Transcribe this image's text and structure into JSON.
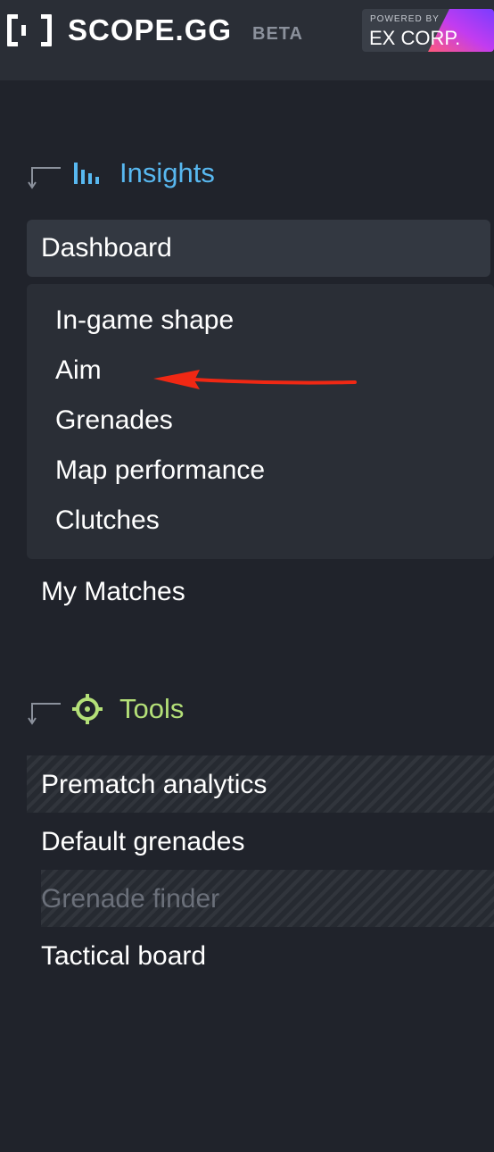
{
  "header": {
    "logo_text": "SCOPE.GG",
    "beta_badge": "BETA",
    "powered_by_label": "POWERED BY",
    "partner_name": "EX CORP."
  },
  "sidebar": {
    "insights": {
      "title": "Insights",
      "icon": "bar-chart-icon",
      "accent": "#58b8f0",
      "items": [
        {
          "label": "Dashboard",
          "active": true
        },
        {
          "label": "In-game shape"
        },
        {
          "label": "Aim"
        },
        {
          "label": "Grenades"
        },
        {
          "label": "Map performance"
        },
        {
          "label": "Clutches"
        },
        {
          "label": "My Matches"
        }
      ]
    },
    "tools": {
      "title": "Tools",
      "icon": "crosshair-icon",
      "accent": "#b4e078",
      "items": [
        {
          "label": "Prematch analytics"
        },
        {
          "label": "Default grenades"
        },
        {
          "label": "Grenade finder",
          "disabled": true
        },
        {
          "label": "Tactical board"
        }
      ]
    }
  },
  "annotation": {
    "arrow_color": "#f02814",
    "points_to": "Aim"
  },
  "colors": {
    "background": "#20232b",
    "topbar": "#2a2e36",
    "active_item": "#333841",
    "disabled_text": "#6b707a"
  }
}
